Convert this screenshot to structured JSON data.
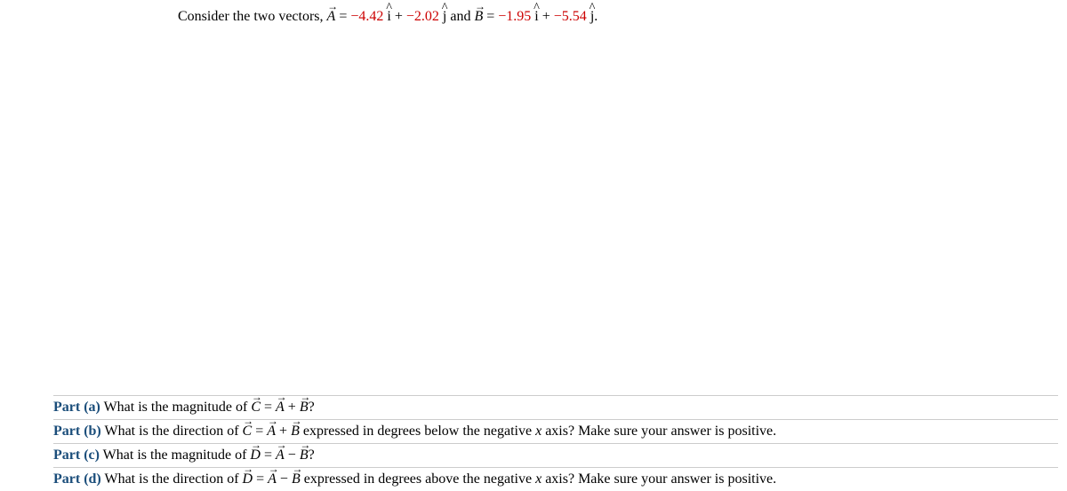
{
  "intro": {
    "prefix": "Consider the two vectors, ",
    "A_label": "A",
    "eq1": " = ",
    "A_i": "−4.42",
    "ihat": "i",
    "plus1": " + ",
    "A_j": "−2.02",
    "jhat": "j",
    "and": " and ",
    "B_label": "B",
    "eq2": " = ",
    "B_i": "−1.95",
    "ihat2": "i",
    "plus2": " + ",
    "B_j": "−5.54",
    "jhat2": "j",
    "period": "."
  },
  "parts": {
    "a": {
      "label": "Part (a)",
      "pre": "  What is the magnitude of ",
      "C": "C",
      "eq": " = ",
      "A": "A",
      "op": " + ",
      "B": "B",
      "post": "?"
    },
    "b": {
      "label": "Part (b)",
      "pre": "  What is the direction of ",
      "C": "C",
      "eq": " = ",
      "A": "A",
      "op": " + ",
      "B": "B",
      "xvar": "x",
      "post1": " expressed in degrees below the negative ",
      "post2": " axis? Make sure your answer is positive."
    },
    "c": {
      "label": "Part (c)",
      "pre": "  What is the magnitude of ",
      "D": "D",
      "eq": " = ",
      "A": "A",
      "op": " − ",
      "B": "B",
      "post": "?"
    },
    "d": {
      "label": "Part (d)",
      "pre": "  What is the direction of ",
      "D": "D",
      "eq": " = ",
      "A": "A",
      "op": " − ",
      "B": "B",
      "xvar": "x",
      "post1": " expressed in degrees above the negative ",
      "post2": " axis? Make sure your answer is positive."
    }
  }
}
